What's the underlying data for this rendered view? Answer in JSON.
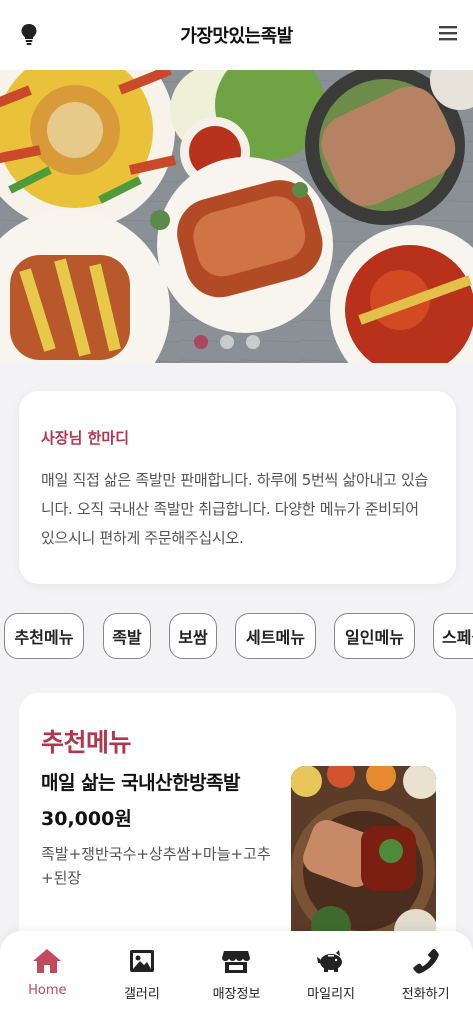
{
  "header": {
    "title": "가장맛있는족발",
    "left_icon": "lightbulb-icon",
    "right_icon": "hamburger-menu-icon"
  },
  "hero": {
    "slides_count": 3,
    "active_slide": 1
  },
  "owner_card": {
    "heading": "사장님 한마디",
    "body": "매일 직접 삶은 족발만 판매합니다. 하루에 5번씩 삶아내고 있습니다. 오직 국내산 족발만 취급합니다. 다양한 메뉴가 준비되어 있으시니 편하게 주문해주십시오."
  },
  "categories": [
    "추천메뉴",
    "족발",
    "보쌈",
    "세트메뉴",
    "일인메뉴",
    "스페셜"
  ],
  "recommended": {
    "section_title": "추천메뉴",
    "name": "매일 삶는 국내산한방족발",
    "price": "30,000원",
    "description": "족발+쟁반국수+상추쌈+마늘+고추+된장"
  },
  "bottom_nav": {
    "items": [
      {
        "label": "Home",
        "icon": "home-icon"
      },
      {
        "label": "갤러리",
        "icon": "image-icon"
      },
      {
        "label": "매장정보",
        "icon": "store-icon"
      },
      {
        "label": "마일리지",
        "icon": "piggy-bank-icon"
      },
      {
        "label": "전화하기",
        "icon": "phone-icon"
      }
    ]
  },
  "colors": {
    "accent": "#b3364f",
    "nav_active": "#c04a5c",
    "background": "#f3f3f6"
  }
}
